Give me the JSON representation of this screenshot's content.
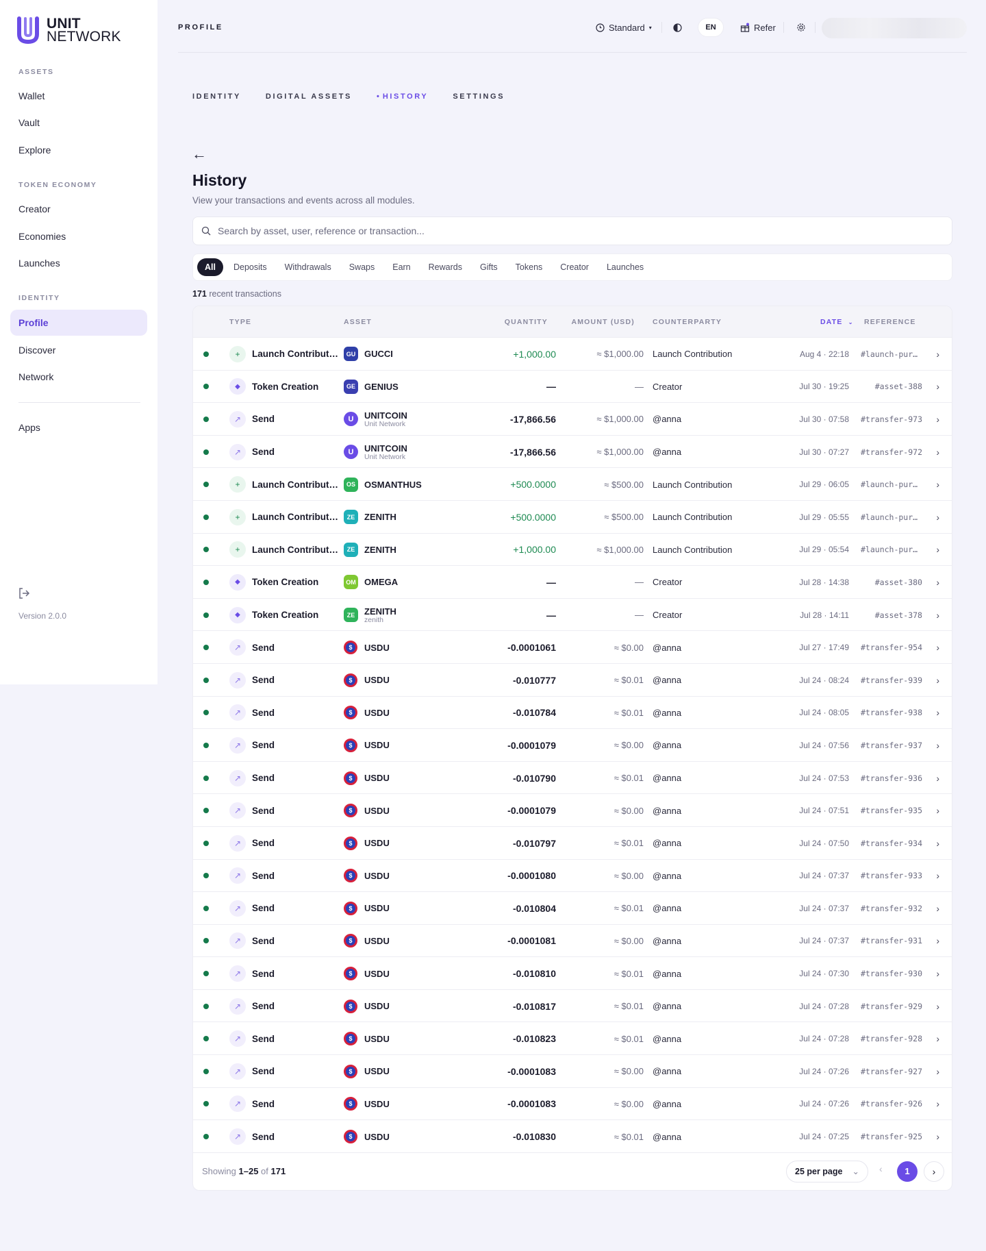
{
  "sidebar": {
    "brand": {
      "line1": "UNIT",
      "line2": "NETWORK"
    },
    "sections": [
      {
        "label": "ASSETS",
        "items": [
          "Wallet",
          "Vault",
          "Explore"
        ]
      },
      {
        "label": "TOKEN ECONOMY",
        "items": [
          "Creator",
          "Economies",
          "Launches"
        ]
      },
      {
        "label": "IDENTITY",
        "items": [
          "Profile",
          "Discover",
          "Network"
        ]
      }
    ],
    "apps_label": "Apps",
    "active_item": "Profile",
    "version": "Version 2.0.0"
  },
  "topbar": {
    "title": "PROFILE",
    "mode": "Standard",
    "language": "EN",
    "refer": "Refer"
  },
  "tabs": {
    "identity": "IDENTITY",
    "digital_assets": "DIGITAL ASSETS",
    "history": "HISTORY",
    "settings": "SETTINGS",
    "active": "HISTORY"
  },
  "page": {
    "back": "←",
    "title": "History",
    "subtitle": "View your transactions and events across all modules."
  },
  "search": {
    "placeholder": "Search by asset, user, reference or transaction..."
  },
  "filters": [
    "All",
    "Deposits",
    "Withdrawals",
    "Swaps",
    "Earn",
    "Rewards",
    "Gifts",
    "Tokens",
    "Creator",
    "Launches"
  ],
  "count": {
    "number": "171",
    "label": "recent transactions"
  },
  "table": {
    "headers": {
      "type": "TYPE",
      "asset": "ASSET",
      "quantity": "QUANTITY",
      "amount": "AMOUNT (USD)",
      "counterparty": "COUNTERPARTY",
      "date": "DATE",
      "reference": "REFERENCE"
    },
    "rows": [
      {
        "type": "Launch Contribution",
        "kind": "plus",
        "badge": "GU",
        "badge_color": "#2f3fa8",
        "asset": "GUCCI",
        "asset_sub": "",
        "qty": "+1,000.00",
        "positive": true,
        "usd": "≈ $1,000.00",
        "cp": "Launch Contribution",
        "date": "Aug 4 · 22:18",
        "ref": "#launch-purchase"
      },
      {
        "type": "Token Creation",
        "kind": "diamond",
        "badge": "GE",
        "badge_color": "#3a3fb0",
        "asset": "GENIUS",
        "asset_sub": "",
        "qty": "—",
        "positive": false,
        "usd": "—",
        "cp": "Creator",
        "date": "Jul 30 · 19:25",
        "ref": "#asset-388"
      },
      {
        "type": "Send",
        "kind": "send",
        "badge": "U",
        "badge_color": "unit",
        "asset": "UNITCOIN",
        "asset_sub": "Unit Network",
        "qty": "-17,866.56",
        "positive": false,
        "usd": "≈ $1,000.00",
        "cp": "@anna",
        "date": "Jul 30 · 07:58",
        "ref": "#transfer-973"
      },
      {
        "type": "Send",
        "kind": "send",
        "badge": "U",
        "badge_color": "unit",
        "asset": "UNITCOIN",
        "asset_sub": "Unit Network",
        "qty": "-17,866.56",
        "positive": false,
        "usd": "≈ $1,000.00",
        "cp": "@anna",
        "date": "Jul 30 · 07:27",
        "ref": "#transfer-972"
      },
      {
        "type": "Launch Contribution",
        "kind": "plus",
        "badge": "OS",
        "badge_color": "#2fb35a",
        "asset": "OSMANTHUS",
        "asset_sub": "",
        "qty": "+500.0000",
        "positive": true,
        "usd": "≈ $500.00",
        "cp": "Launch Contribution",
        "date": "Jul 29 · 06:05",
        "ref": "#launch-purchase"
      },
      {
        "type": "Launch Contribution",
        "kind": "plus",
        "badge": "ZE",
        "badge_color": "#1fb0b8",
        "asset": "ZENITH",
        "asset_sub": "",
        "qty": "+500.0000",
        "positive": true,
        "usd": "≈ $500.00",
        "cp": "Launch Contribution",
        "date": "Jul 29 · 05:55",
        "ref": "#launch-purchase"
      },
      {
        "type": "Launch Contribution",
        "kind": "plus",
        "badge": "ZE",
        "badge_color": "#1fb0b8",
        "asset": "ZENITH",
        "asset_sub": "",
        "qty": "+1,000.00",
        "positive": true,
        "usd": "≈ $1,000.00",
        "cp": "Launch Contribution",
        "date": "Jul 29 · 05:54",
        "ref": "#launch-purchase"
      },
      {
        "type": "Token Creation",
        "kind": "diamond",
        "badge": "OM",
        "badge_color": "#7fc832",
        "asset": "OMEGA",
        "asset_sub": "",
        "qty": "—",
        "positive": false,
        "usd": "—",
        "cp": "Creator",
        "date": "Jul 28 · 14:38",
        "ref": "#asset-380"
      },
      {
        "type": "Token Creation",
        "kind": "diamond",
        "badge": "ZE",
        "badge_color": "#2fb35a",
        "asset": "ZENITH",
        "asset_sub": "zenith",
        "qty": "—",
        "positive": false,
        "usd": "—",
        "cp": "Creator",
        "date": "Jul 28 · 14:11",
        "ref": "#asset-378"
      },
      {
        "type": "Send",
        "kind": "send",
        "badge": "$",
        "badge_color": "coin",
        "asset": "USDU",
        "asset_sub": "",
        "qty": "-0.0001061",
        "positive": false,
        "usd": "≈ $0.00",
        "cp": "@anna",
        "date": "Jul 27 · 17:49",
        "ref": "#transfer-954"
      },
      {
        "type": "Send",
        "kind": "send",
        "badge": "$",
        "badge_color": "coin",
        "asset": "USDU",
        "asset_sub": "",
        "qty": "-0.010777",
        "positive": false,
        "usd": "≈ $0.01",
        "cp": "@anna",
        "date": "Jul 24 · 08:24",
        "ref": "#transfer-939"
      },
      {
        "type": "Send",
        "kind": "send",
        "badge": "$",
        "badge_color": "coin",
        "asset": "USDU",
        "asset_sub": "",
        "qty": "-0.010784",
        "positive": false,
        "usd": "≈ $0.01",
        "cp": "@anna",
        "date": "Jul 24 · 08:05",
        "ref": "#transfer-938"
      },
      {
        "type": "Send",
        "kind": "send",
        "badge": "$",
        "badge_color": "coin",
        "asset": "USDU",
        "asset_sub": "",
        "qty": "-0.0001079",
        "positive": false,
        "usd": "≈ $0.00",
        "cp": "@anna",
        "date": "Jul 24 · 07:56",
        "ref": "#transfer-937"
      },
      {
        "type": "Send",
        "kind": "send",
        "badge": "$",
        "badge_color": "coin",
        "asset": "USDU",
        "asset_sub": "",
        "qty": "-0.010790",
        "positive": false,
        "usd": "≈ $0.01",
        "cp": "@anna",
        "date": "Jul 24 · 07:53",
        "ref": "#transfer-936"
      },
      {
        "type": "Send",
        "kind": "send",
        "badge": "$",
        "badge_color": "coin",
        "asset": "USDU",
        "asset_sub": "",
        "qty": "-0.0001079",
        "positive": false,
        "usd": "≈ $0.00",
        "cp": "@anna",
        "date": "Jul 24 · 07:51",
        "ref": "#transfer-935"
      },
      {
        "type": "Send",
        "kind": "send",
        "badge": "$",
        "badge_color": "coin",
        "asset": "USDU",
        "asset_sub": "",
        "qty": "-0.010797",
        "positive": false,
        "usd": "≈ $0.01",
        "cp": "@anna",
        "date": "Jul 24 · 07:50",
        "ref": "#transfer-934"
      },
      {
        "type": "Send",
        "kind": "send",
        "badge": "$",
        "badge_color": "coin",
        "asset": "USDU",
        "asset_sub": "",
        "qty": "-0.0001080",
        "positive": false,
        "usd": "≈ $0.00",
        "cp": "@anna",
        "date": "Jul 24 · 07:37",
        "ref": "#transfer-933"
      },
      {
        "type": "Send",
        "kind": "send",
        "badge": "$",
        "badge_color": "coin",
        "asset": "USDU",
        "asset_sub": "",
        "qty": "-0.010804",
        "positive": false,
        "usd": "≈ $0.01",
        "cp": "@anna",
        "date": "Jul 24 · 07:37",
        "ref": "#transfer-932"
      },
      {
        "type": "Send",
        "kind": "send",
        "badge": "$",
        "badge_color": "coin",
        "asset": "USDU",
        "asset_sub": "",
        "qty": "-0.0001081",
        "positive": false,
        "usd": "≈ $0.00",
        "cp": "@anna",
        "date": "Jul 24 · 07:37",
        "ref": "#transfer-931"
      },
      {
        "type": "Send",
        "kind": "send",
        "badge": "$",
        "badge_color": "coin",
        "asset": "USDU",
        "asset_sub": "",
        "qty": "-0.010810",
        "positive": false,
        "usd": "≈ $0.01",
        "cp": "@anna",
        "date": "Jul 24 · 07:30",
        "ref": "#transfer-930"
      },
      {
        "type": "Send",
        "kind": "send",
        "badge": "$",
        "badge_color": "coin",
        "asset": "USDU",
        "asset_sub": "",
        "qty": "-0.010817",
        "positive": false,
        "usd": "≈ $0.01",
        "cp": "@anna",
        "date": "Jul 24 · 07:28",
        "ref": "#transfer-929"
      },
      {
        "type": "Send",
        "kind": "send",
        "badge": "$",
        "badge_color": "coin",
        "asset": "USDU",
        "asset_sub": "",
        "qty": "-0.010823",
        "positive": false,
        "usd": "≈ $0.01",
        "cp": "@anna",
        "date": "Jul 24 · 07:28",
        "ref": "#transfer-928"
      },
      {
        "type": "Send",
        "kind": "send",
        "badge": "$",
        "badge_color": "coin",
        "asset": "USDU",
        "asset_sub": "",
        "qty": "-0.0001083",
        "positive": false,
        "usd": "≈ $0.00",
        "cp": "@anna",
        "date": "Jul 24 · 07:26",
        "ref": "#transfer-927"
      },
      {
        "type": "Send",
        "kind": "send",
        "badge": "$",
        "badge_color": "coin",
        "asset": "USDU",
        "asset_sub": "",
        "qty": "-0.0001083",
        "positive": false,
        "usd": "≈ $0.00",
        "cp": "@anna",
        "date": "Jul 24 · 07:26",
        "ref": "#transfer-926"
      },
      {
        "type": "Send",
        "kind": "send",
        "badge": "$",
        "badge_color": "coin",
        "asset": "USDU",
        "asset_sub": "",
        "qty": "-0.010830",
        "positive": false,
        "usd": "≈ $0.01",
        "cp": "@anna",
        "date": "Jul 24 · 07:25",
        "ref": "#transfer-925"
      }
    ]
  },
  "footer": {
    "showing_prefix": "Showing",
    "range": "1–25",
    "of": "of",
    "total": "171",
    "per_page": "25 per page",
    "current_page": "1"
  },
  "colors": {
    "accent": "#6a4ce6",
    "positive": "#1e8a52",
    "status_dot": "#157a4b"
  }
}
